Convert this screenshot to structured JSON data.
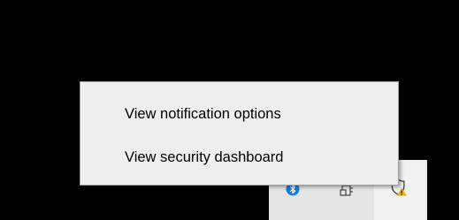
{
  "context_menu": {
    "items": [
      {
        "label": "View notification options"
      },
      {
        "label": "View security dashboard"
      }
    ]
  },
  "tray": {
    "icons": [
      {
        "name": "bluetooth-icon",
        "color": "#1e7bd8"
      },
      {
        "name": "usb-device-icon",
        "color": "#333333"
      },
      {
        "name": "windows-security-warning-icon",
        "color": "#333333",
        "badge_color": "#f0b400"
      }
    ]
  },
  "colors": {
    "background": "#000000",
    "menu_background": "#eeeeee",
    "menu_border": "#a0a0a0",
    "tray_background": "#e6e6e6"
  }
}
